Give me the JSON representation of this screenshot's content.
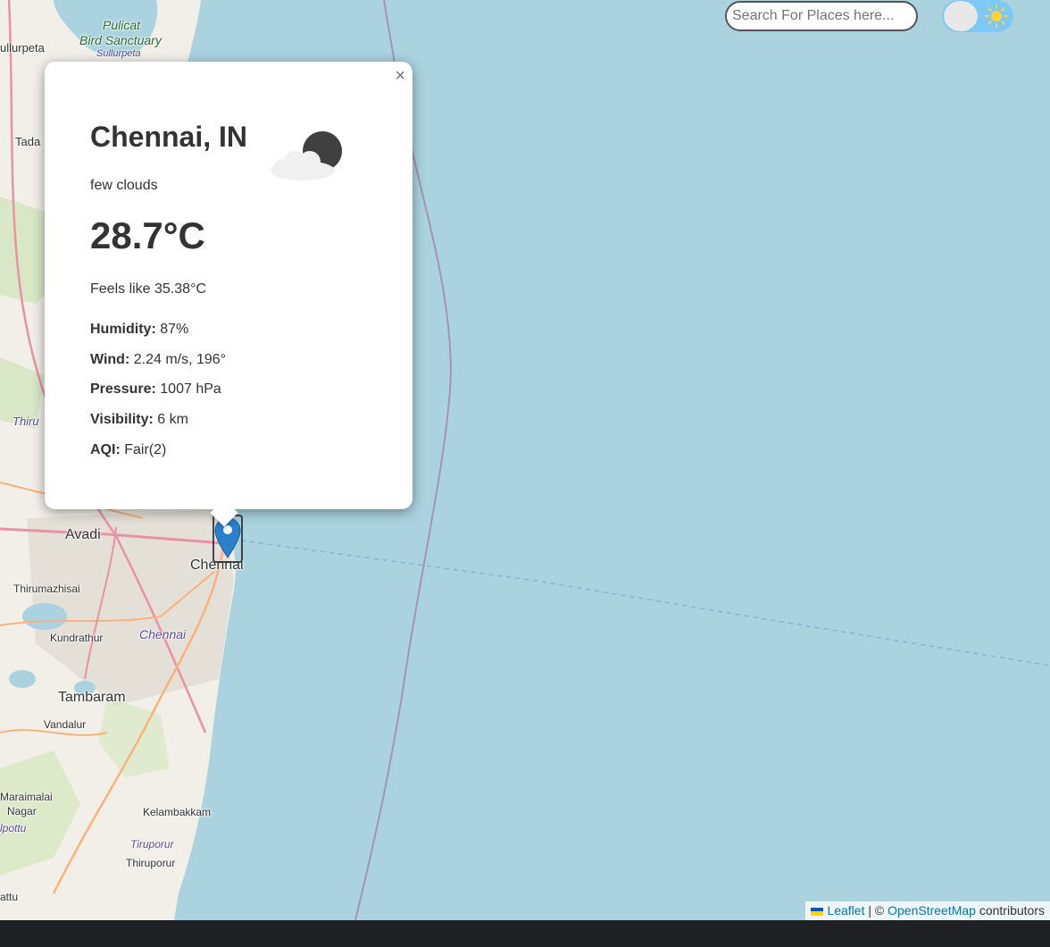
{
  "search": {
    "placeholder": "Search For Places here..."
  },
  "theme_toggle": {
    "icon": "sun-icon",
    "state": "light"
  },
  "popup": {
    "city": "Chennai, IN",
    "description": "few clouds",
    "temperature": "28.7°C",
    "feels_like": "Feels like 35.38°C",
    "weather_icon": "partly-cloudy-night-icon",
    "close_label": "×",
    "details": [
      {
        "label": "Humidity:",
        "value": "87%"
      },
      {
        "label": "Wind:",
        "value": "2.24 m/s, 196°"
      },
      {
        "label": "Pressure:",
        "value": "1007 hPa"
      },
      {
        "label": "Visibility:",
        "value": "6 km"
      },
      {
        "label": "AQI:",
        "value": "Fair(2)"
      }
    ]
  },
  "map_labels": {
    "sullurpeta": "ullurpeta",
    "pulicat_1": "Pulicat",
    "pulicat_2": "Bird Sanctuary",
    "sullurpeta_sub": "Sullurpeta",
    "tada": "Tada",
    "thiru": "Thiru",
    "avadi": "Avadi",
    "chennai": "Chennai",
    "thirumazhisai": "Thirumazhisai",
    "kundrathur": "Kundrathur",
    "chennai_district": "Chennai",
    "tambaram": "Tambaram",
    "vandalur": "Vandalur",
    "maraimalai": "Maraimalai",
    "nagar": "Nagar",
    "alpottu": "lpottu",
    "kelambakkam": "Kelambakkam",
    "tiruporur_it": "Tiruporur",
    "thiruporur": "Thiruporur",
    "attu": "attu"
  },
  "attribution": {
    "leaflet": "Leaflet",
    "separator": " | © ",
    "osm": "OpenStreetMap",
    "contributors": " contributors"
  },
  "colors": {
    "sea": "#aad3df",
    "land": "#f2efe9",
    "popup_bg": "#ffffff",
    "marker": "#2a81cb",
    "toggle": "#7ec8f7"
  }
}
